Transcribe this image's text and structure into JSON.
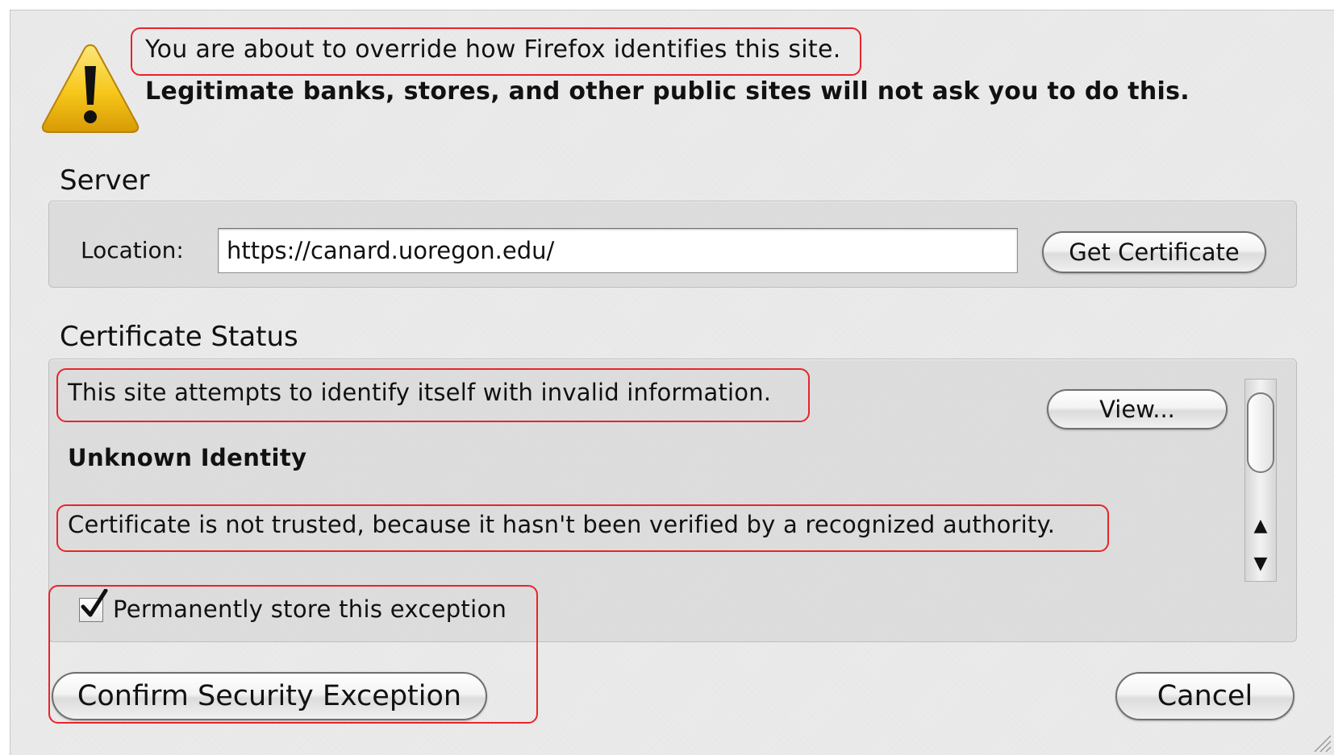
{
  "warning": {
    "icon": "warning-triangle-icon",
    "line1": "You are about to override how Firefox identifies this site.",
    "line2": "Legitimate banks, stores, and other public sites will not ask you to do this."
  },
  "server": {
    "title": "Server",
    "location_label": "Location:",
    "location_value": "https://canard.uoregon.edu/",
    "get_certificate_label": "Get Certificate"
  },
  "certificate_status": {
    "title": "Certificate Status",
    "message": "This site attempts to identify itself with invalid information.",
    "identity_title": "Unknown Identity",
    "detail": "Certificate is not trusted, because it hasn't been verified by a recognized authority.",
    "view_label": "View..."
  },
  "permanent_exception": {
    "label": "Permanently store this exception",
    "checked": true
  },
  "buttons": {
    "confirm_label": "Confirm Security Exception",
    "cancel_label": "Cancel"
  },
  "colors": {
    "highlight": "#e8242a",
    "dialog_background": "#e9e9e9",
    "warning_yellow": "#f6c619"
  }
}
